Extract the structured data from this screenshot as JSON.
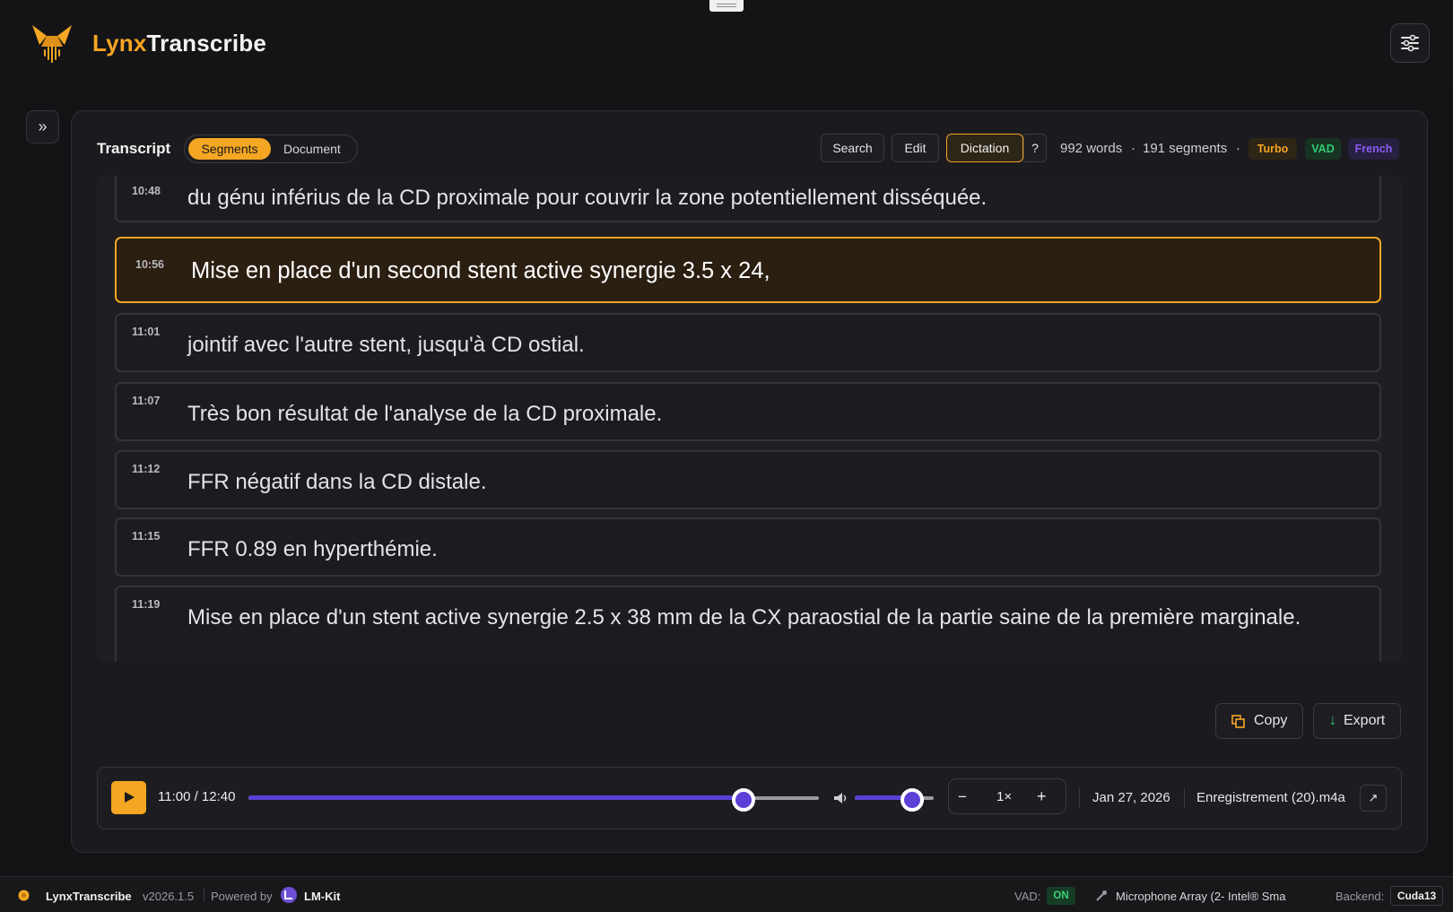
{
  "app": {
    "name_part1": "Lynx",
    "name_part2": "Transcribe"
  },
  "transcript": {
    "title": "Transcript",
    "view_tabs": [
      "Segments",
      "Document"
    ],
    "toolbar": {
      "search": "Search",
      "edit": "Edit",
      "dictation": "Dictation",
      "help": "?"
    },
    "word_count": "992 words",
    "segment_count": "191 segments",
    "separator": "·",
    "badges": [
      {
        "label": "Turbo",
        "color": "#f5a623"
      },
      {
        "label": "VAD",
        "color": "#2ecc71"
      },
      {
        "label": "French",
        "color": "#8b5cf6"
      }
    ],
    "segments": [
      {
        "time": "10:48",
        "text": "du génu inférius de la CD proximale pour couvrir la zone potentiellement disséquée."
      },
      {
        "time": "10:56",
        "text": "Mise en place d'un second stent active synergie 3.5 x 24,",
        "active": true
      },
      {
        "time": "11:01",
        "text": "jointif avec l'autre stent, jusqu'à CD ostial."
      },
      {
        "time": "11:07",
        "text": "Très bon résultat de l'analyse de la CD proximale."
      },
      {
        "time": "11:12",
        "text": "FFR négatif dans la CD distale."
      },
      {
        "time": "11:15",
        "text": "FFR 0.89 en hyperthémie."
      },
      {
        "time": "11:19",
        "text": "Mise en place d'un stent active synergie 2.5 x 38 mm de la CX paraostial de la partie saine de la première marginale."
      }
    ],
    "actions": {
      "copy": "Copy",
      "export": "Export"
    }
  },
  "player": {
    "time_display": "11:00 / 12:40",
    "progress_fraction": 0.868,
    "volume_fraction": 0.73,
    "speed": "1×",
    "speed_minus": "−",
    "speed_plus": "+",
    "date": "Jan 27, 2026",
    "filename": "Enregistrement (20).m4a",
    "open_external": "↗"
  },
  "statusbar": {
    "app_name": "LynxTranscribe",
    "version": "v2026.1.5",
    "powered_by": "Powered by",
    "powered_by_name": "LM-Kit",
    "vad_label": "VAD:",
    "vad_value": "ON",
    "microphone": "Microphone Array (2- Intel® Sma",
    "backend_label": "Backend:",
    "backend_value": "Cuda13"
  },
  "colors": {
    "accent": "#f5a623",
    "progress": "#5b3fd6",
    "background": "#111113"
  },
  "icons": [
    "lynx-logo-icon",
    "settings-sliders-icon",
    "expand-chevrons-icon",
    "play-icon",
    "volume-icon",
    "copy-icon",
    "download-icon",
    "external-link-icon",
    "microphone-icon",
    "lm-kit-logo-icon"
  ]
}
